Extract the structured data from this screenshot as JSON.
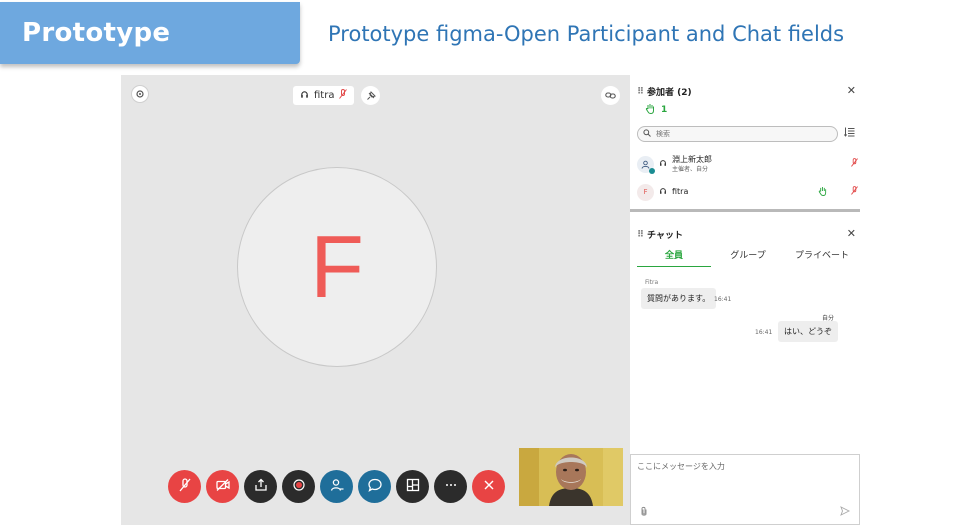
{
  "header": {
    "badge_label": "Prototype",
    "title": "Prototype figma-Open Participant and Chat fields"
  },
  "stage": {
    "speaker_name": "fitra",
    "avatar_letter": "F",
    "controls": [
      {
        "name": "mute-mic",
        "icon": "mic-off-icon",
        "color": "#e84444"
      },
      {
        "name": "camera-off",
        "icon": "video-off-icon",
        "color": "#e84444"
      },
      {
        "name": "share-screen",
        "icon": "share-icon",
        "color": "#2b2b2b"
      },
      {
        "name": "record",
        "icon": "record-icon",
        "color": "#2b2b2b"
      },
      {
        "name": "participants",
        "icon": "participants-icon",
        "color": "#1f6e9a"
      },
      {
        "name": "chat",
        "icon": "chat-icon",
        "color": "#1f6e9a"
      },
      {
        "name": "layout",
        "icon": "layout-icon",
        "color": "#2b2b2b"
      },
      {
        "name": "more",
        "icon": "more-icon",
        "color": "#2b2b2b"
      },
      {
        "name": "leave",
        "icon": "close-icon",
        "color": "#e84444"
      }
    ]
  },
  "participants": {
    "title": "参加者 (2)",
    "raised_hands": "1",
    "search_placeholder": "検索",
    "list": [
      {
        "name": "淵上新太郎",
        "subtitle": "主催者、自分",
        "avatar": ""
      },
      {
        "name": "fitra",
        "subtitle": "",
        "avatar": "F"
      }
    ]
  },
  "chat": {
    "title": "チャット",
    "tabs": [
      "全員",
      "グループ",
      "プライベート"
    ],
    "active_tab": 0,
    "messages": [
      {
        "sender": "Fitra",
        "text": "質問があります。",
        "time": "16:41",
        "self": false
      },
      {
        "sender": "自分",
        "text": "はい、どうぞ",
        "time": "16:41",
        "self": true
      }
    ],
    "input_placeholder": "ここにメッセージを入力"
  },
  "colors": {
    "badge": "#6ea8df",
    "title": "#2f75b5",
    "accent_green": "#2aa63f",
    "danger_red": "#e84444",
    "control_blue": "#1f6e9a"
  }
}
